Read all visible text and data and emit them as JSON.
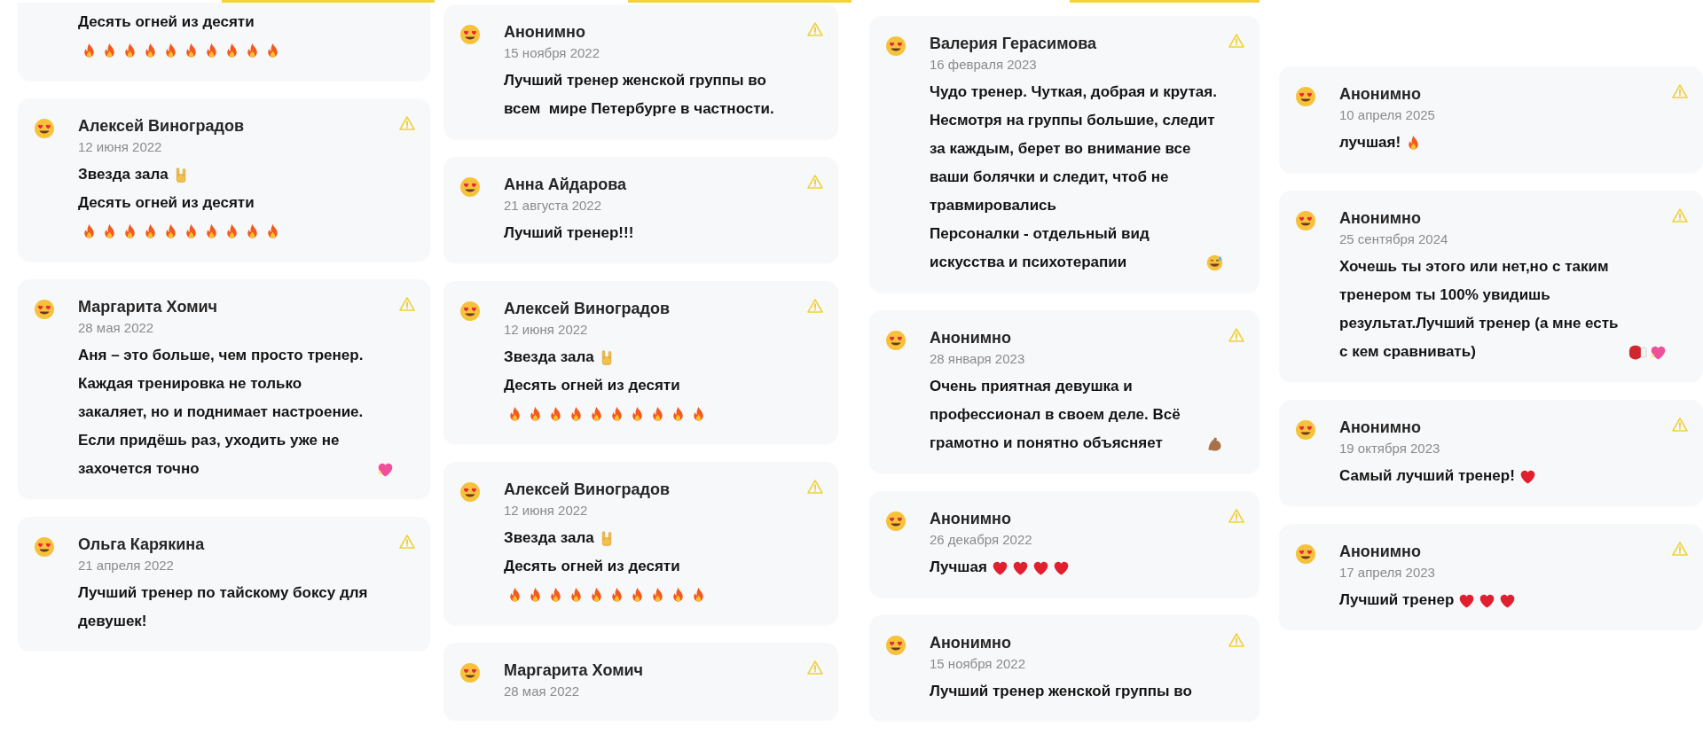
{
  "columns": [
    {
      "reviews": [
        {
          "paragraphs": [
            {
              "text": "Десять огней из десяти"
            },
            {
              "emojis": [
                {
                  "kind": "fire"
                },
                {
                  "kind": "fire"
                },
                {
                  "kind": "fire"
                },
                {
                  "kind": "fire"
                },
                {
                  "kind": "fire"
                },
                {
                  "kind": "fire"
                },
                {
                  "kind": "fire"
                },
                {
                  "kind": "fire"
                },
                {
                  "kind": "fire"
                },
                {
                  "kind": "fire"
                }
              ]
            }
          ]
        },
        {
          "author": "Алексей Виноградов",
          "date": "12 июня 2022",
          "paragraphs": [
            {
              "text": "Звезда зала",
              "emojis": [
                {
                  "kind": "horns"
                }
              ]
            },
            {
              "text": "Десять огней из десяти"
            },
            {
              "emojis": [
                {
                  "kind": "fire"
                },
                {
                  "kind": "fire"
                },
                {
                  "kind": "fire"
                },
                {
                  "kind": "fire"
                },
                {
                  "kind": "fire"
                },
                {
                  "kind": "fire"
                },
                {
                  "kind": "fire"
                },
                {
                  "kind": "fire"
                },
                {
                  "kind": "fire"
                },
                {
                  "kind": "fire"
                }
              ]
            }
          ]
        },
        {
          "author": "Маргарита Хомич",
          "date": "28 мая 2022",
          "paragraphs": [
            {
              "text": "Аня – это больше, чем просто тренер. Каждая тренировка не только закаляет, но и поднимает настроение. Если придёшь раз, уходить уже не захочется точно",
              "emojis": [
                {
                  "kind": "sparkling-heart"
                }
              ]
            }
          ]
        },
        {
          "author": "Ольга Карякина",
          "date": "21 апреля 2022",
          "paragraphs": [
            {
              "text": "Лучший тренер по тайскому боксу для девушек!"
            }
          ]
        }
      ]
    },
    {
      "reviews": [
        {
          "author": "Анонимно",
          "date": "15 ноября 2022",
          "paragraphs": [
            {
              "text": "Лучший тренер женской группы во всем  мире Петербурге в частности."
            }
          ]
        },
        {
          "author": "Анна Айдарова",
          "date": "21 августа 2022",
          "paragraphs": [
            {
              "text": "Лучший тренер!!!"
            }
          ]
        },
        {
          "author": "Алексей Виноградов",
          "date": "12 июня 2022",
          "paragraphs": [
            {
              "text": "Звезда зала",
              "emojis": [
                {
                  "kind": "horns"
                }
              ]
            },
            {
              "text": "Десять огней из десяти"
            },
            {
              "emojis": [
                {
                  "kind": "fire"
                },
                {
                  "kind": "fire"
                },
                {
                  "kind": "fire"
                },
                {
                  "kind": "fire"
                },
                {
                  "kind": "fire"
                },
                {
                  "kind": "fire"
                },
                {
                  "kind": "fire"
                },
                {
                  "kind": "fire"
                },
                {
                  "kind": "fire"
                },
                {
                  "kind": "fire"
                }
              ]
            }
          ]
        },
        {
          "author": "Алексей Виноградов",
          "date": "12 июня 2022",
          "paragraphs": [
            {
              "text": "Звезда зала",
              "emojis": [
                {
                  "kind": "horns"
                }
              ]
            },
            {
              "text": "Десять огней из десяти"
            },
            {
              "emojis": [
                {
                  "kind": "fire"
                },
                {
                  "kind": "fire"
                },
                {
                  "kind": "fire"
                },
                {
                  "kind": "fire"
                },
                {
                  "kind": "fire"
                },
                {
                  "kind": "fire"
                },
                {
                  "kind": "fire"
                },
                {
                  "kind": "fire"
                },
                {
                  "kind": "fire"
                },
                {
                  "kind": "fire"
                }
              ]
            }
          ]
        },
        {
          "author": "Маргарита Хомич",
          "date": "28 мая 2022"
        }
      ]
    },
    {
      "reviews": [
        {
          "author": "Валерия Герасимова",
          "date": "16 февраля 2023",
          "paragraphs": [
            {
              "text": "Чудо тренер. Чуткая, добрая и крутая. Несмотря на группы большие, следит за каждым, берет во внимание все ваши болячки и следит, чтоб не травмировались"
            },
            {
              "text": "Персоналки - отдельный вид искусства и психотерапии",
              "emojis": [
                {
                  "kind": "sweat-smile"
                }
              ]
            }
          ]
        },
        {
          "author": "Анонимно",
          "date": "28 января 2023",
          "paragraphs": [
            {
              "text": "Очень приятная девушка и профессионал в своем деле. Всё грамотно и понятно объясняет",
              "emojis": [
                {
                  "kind": "muscle"
                }
              ]
            }
          ]
        },
        {
          "author": "Анонимно",
          "date": "26 декабря 2022",
          "paragraphs": [
            {
              "text": "Лучшая",
              "emojis": [
                {
                  "kind": "heart"
                },
                {
                  "kind": "heart"
                },
                {
                  "kind": "heart"
                },
                {
                  "kind": "heart"
                }
              ]
            }
          ]
        },
        {
          "author": "Анонимно",
          "date": "15 ноября 2022",
          "paragraphs": [
            {
              "text": "Лучший тренер женской группы во"
            }
          ]
        }
      ]
    },
    {
      "reviews": [
        {
          "author": "Анонимно",
          "date": "10 апреля 2025",
          "paragraphs": [
            {
              "text": "лучшая!",
              "emojis": [
                {
                  "kind": "fire"
                }
              ]
            }
          ]
        },
        {
          "author": "Анонимно",
          "date": "25 сентября 2024",
          "paragraphs": [
            {
              "text": "Хочешь ты этого или нет,но с таким тренером ты 100% увидишь результат.Лучший тренер (а мне есть с кем сравнивать)",
              "emojis": [
                {
                  "kind": "boxing-glove"
                },
                {
                  "kind": "sparkling-heart"
                }
              ]
            }
          ]
        },
        {
          "author": "Анонимно",
          "date": "19 октября 2023",
          "paragraphs": [
            {
              "text": "Самый лучший тренер!",
              "emojis": [
                {
                  "kind": "heart"
                }
              ]
            }
          ]
        },
        {
          "author": "Анонимно",
          "date": "17 апреля 2023",
          "paragraphs": [
            {
              "text": "Лучший тренер",
              "emojis": [
                {
                  "kind": "heart"
                },
                {
                  "kind": "heart"
                },
                {
                  "kind": "heart"
                }
              ]
            }
          ]
        }
      ]
    }
  ]
}
